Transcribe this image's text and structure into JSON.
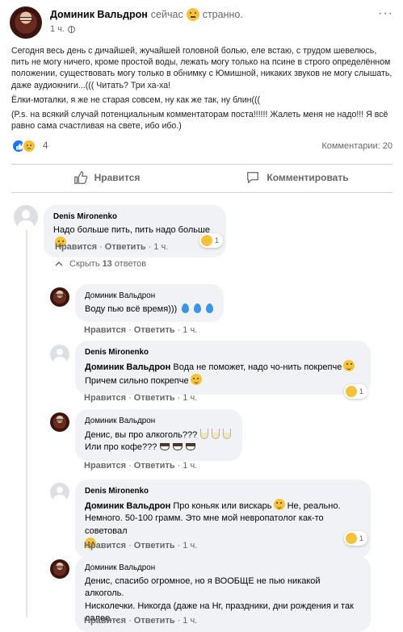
{
  "post": {
    "author": "Доминик Вальдрон",
    "status_prefix": "сейчас",
    "feeling": "странно.",
    "time": "1 ч.",
    "paragraphs": [
      "Сегодня весь день с дичайшей, жучайшей головной болью, еле встаю, с трудом шевелюсь, пить не могу ничего, кроме простой воды, лежать могу только на псине в строго определённом положении, существовать могу только в обнимку с Юмишной, никаких звуков не могу слышать, даже аудиокниги...((( Читать? Три ха-ха!",
      "Ёлки-моталки, я же не старая совсем, ну как же так, ну блин(((",
      "(P.s. на всякий случай потенциальным комментаторам поста!!!!!! Жалеть меня не надо!!! Я всё равно сама счастливая на свете, ибо ибо.)"
    ],
    "reactions_count": "4",
    "comments_count": "Комментарии: 20"
  },
  "actions": {
    "like": "Нравится",
    "comment": "Комментировать"
  },
  "hide_replies": {
    "prefix": "Скрыть",
    "count": "13",
    "suffix": "ответов"
  },
  "comment_actions": {
    "like": "Нравится",
    "reply": "Ответить"
  },
  "comments": [
    {
      "name": "Denis Mironenko",
      "text": "Надо больше пить, пить надо больше",
      "time": "1 ч.",
      "reaction_count": "1"
    },
    {
      "name": "Доминик Вальдрон",
      "text": "Воду пью всё время)))",
      "time": "1 ч."
    },
    {
      "name": "Denis Mironenko",
      "mention": "Доминик Вальдрон",
      "line1": "Вода не поможет, надо чо-нить покрепче",
      "line2": "Причем сильно покрепче",
      "time": "1 ч.",
      "reaction_count": "1"
    },
    {
      "name": "Доминик Вальдрон",
      "line1": "Денис, вы про алкоголь???",
      "line2": "Или про кофе???",
      "time": "1 ч."
    },
    {
      "name": "Denis Mironenko",
      "mention": "Доминик Вальдрон",
      "line1": "Про коньяк или вискарь",
      "line1b": "Не, реально.",
      "line2": "Немного. 50-100 грамм. Это мне мой невропатолог как-то советовал",
      "time": "1 ч.",
      "reaction_count": "1"
    },
    {
      "name": "Доминик Вальдрон",
      "line1": "Денис, спасибо огромное, но я ВООБЩЕ не пью никакой алкоголь.",
      "line2": "Нисколечки. Никогда (даже на Нг, праздники, дни рождения и так",
      "line3": "далее....",
      "time": "1 ч."
    }
  ],
  "colors": {
    "accent": "#1877f2",
    "bubble": "#f0f2f5",
    "muted": "#65676b"
  }
}
